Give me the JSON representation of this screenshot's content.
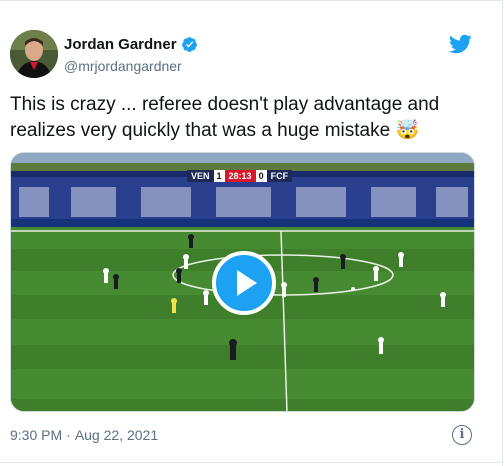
{
  "author": {
    "name": "Jordan Gardner",
    "handle": "@mrjordangardner",
    "verified": true,
    "avatar_icon": "person-avatar"
  },
  "tweet": {
    "text": "This is crazy ... referee doesn't play advantage and realizes very quickly that was a huge mistake 🤯",
    "time": "9:30 PM",
    "separator": "·",
    "date": "Aug 22, 2021"
  },
  "media": {
    "type": "video",
    "scoreboard": {
      "home": "VEN",
      "home_score": "1",
      "time": "28:13",
      "away_score": "0",
      "away": "FCF"
    },
    "play_icon": "play-icon"
  },
  "icons": {
    "brand": "twitter-bird-icon",
    "info": "info-icon"
  },
  "colors": {
    "twitter_blue": "#1da1f2",
    "text_primary": "#0f1419",
    "text_secondary": "#5b7083"
  }
}
